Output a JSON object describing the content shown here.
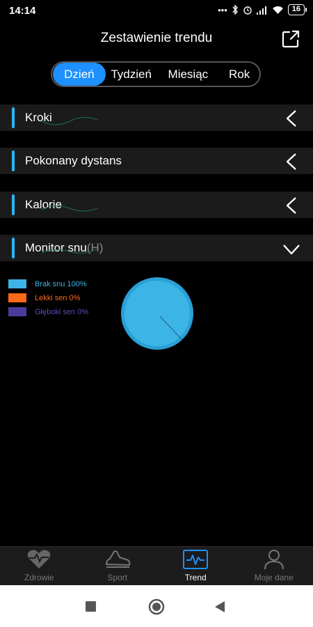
{
  "status": {
    "time": "14:14",
    "battery": "16"
  },
  "header": {
    "title": "Zestawienie trendu"
  },
  "tabs": [
    {
      "label": "Dzień",
      "active": true
    },
    {
      "label": "Tydzień",
      "active": false
    },
    {
      "label": "Miesiąc",
      "active": false
    },
    {
      "label": "Rok",
      "active": false
    }
  ],
  "sections": [
    {
      "label": "Kroki",
      "expanded": false
    },
    {
      "label": "Pokonany dystans",
      "expanded": false
    },
    {
      "label": "Kalorie",
      "expanded": false
    },
    {
      "label": "Monitor snu",
      "unit": "(H)",
      "expanded": true
    }
  ],
  "sleep_legend": [
    {
      "label": "Brak snu",
      "value": "100%",
      "color": "#3cb4e6"
    },
    {
      "label": "Lekki sen",
      "value": "0%",
      "color": "#ff6a1a"
    },
    {
      "label": "Głęboki sen",
      "value": "0%",
      "color": "#4a3c9c"
    }
  ],
  "bottom_nav": [
    {
      "label": "Zdrowie",
      "icon": "heart-pulse-icon",
      "active": false
    },
    {
      "label": "Sport",
      "icon": "sneaker-icon",
      "active": false
    },
    {
      "label": "Trend",
      "icon": "trend-chart-icon",
      "active": true
    },
    {
      "label": "Moje dane",
      "icon": "person-icon",
      "active": false
    }
  ],
  "colors": {
    "accent": "#1e90ff",
    "section_bar": "#29b6f6",
    "pie": "#3cb4e6"
  }
}
